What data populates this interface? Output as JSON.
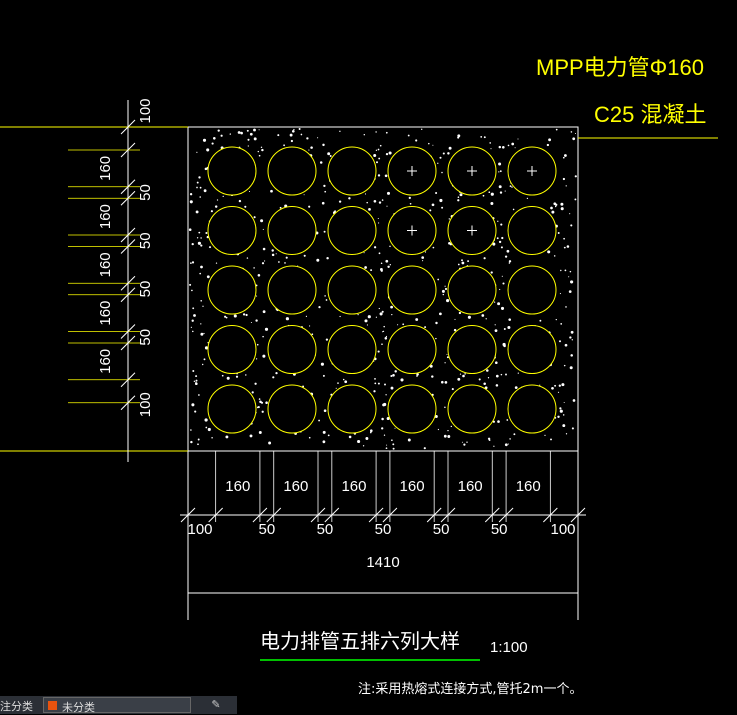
{
  "labels": {
    "pipe_label": "MPP电力管Φ160",
    "concrete_label": "C25 混凝土",
    "title": "电力排管五排六列大样",
    "scale": "1:100",
    "note": "注:采用热熔式连接方式,管托2m一个。",
    "total_width": "1410"
  },
  "dims_horizontal": [
    "100",
    "160",
    "50",
    "160",
    "50",
    "160",
    "50",
    "160",
    "50",
    "160",
    "50",
    "160",
    "100"
  ],
  "dims_vertical": [
    "100",
    "160",
    "50",
    "160",
    "50",
    "160",
    "50",
    "160",
    "50",
    "160",
    "100"
  ],
  "grid": {
    "rows": 5,
    "cols": 6,
    "marked_cells": [
      [
        0,
        3
      ],
      [
        0,
        4
      ],
      [
        0,
        5
      ],
      [
        1,
        3
      ],
      [
        1,
        4
      ]
    ]
  },
  "statusbar": {
    "label": "注分类",
    "selected": "未分类"
  },
  "colors": {
    "background": "#000000",
    "outline": "#ffffff",
    "pipe": "#ffff00",
    "leader": "#ffff00",
    "underline": "#00ff00"
  }
}
